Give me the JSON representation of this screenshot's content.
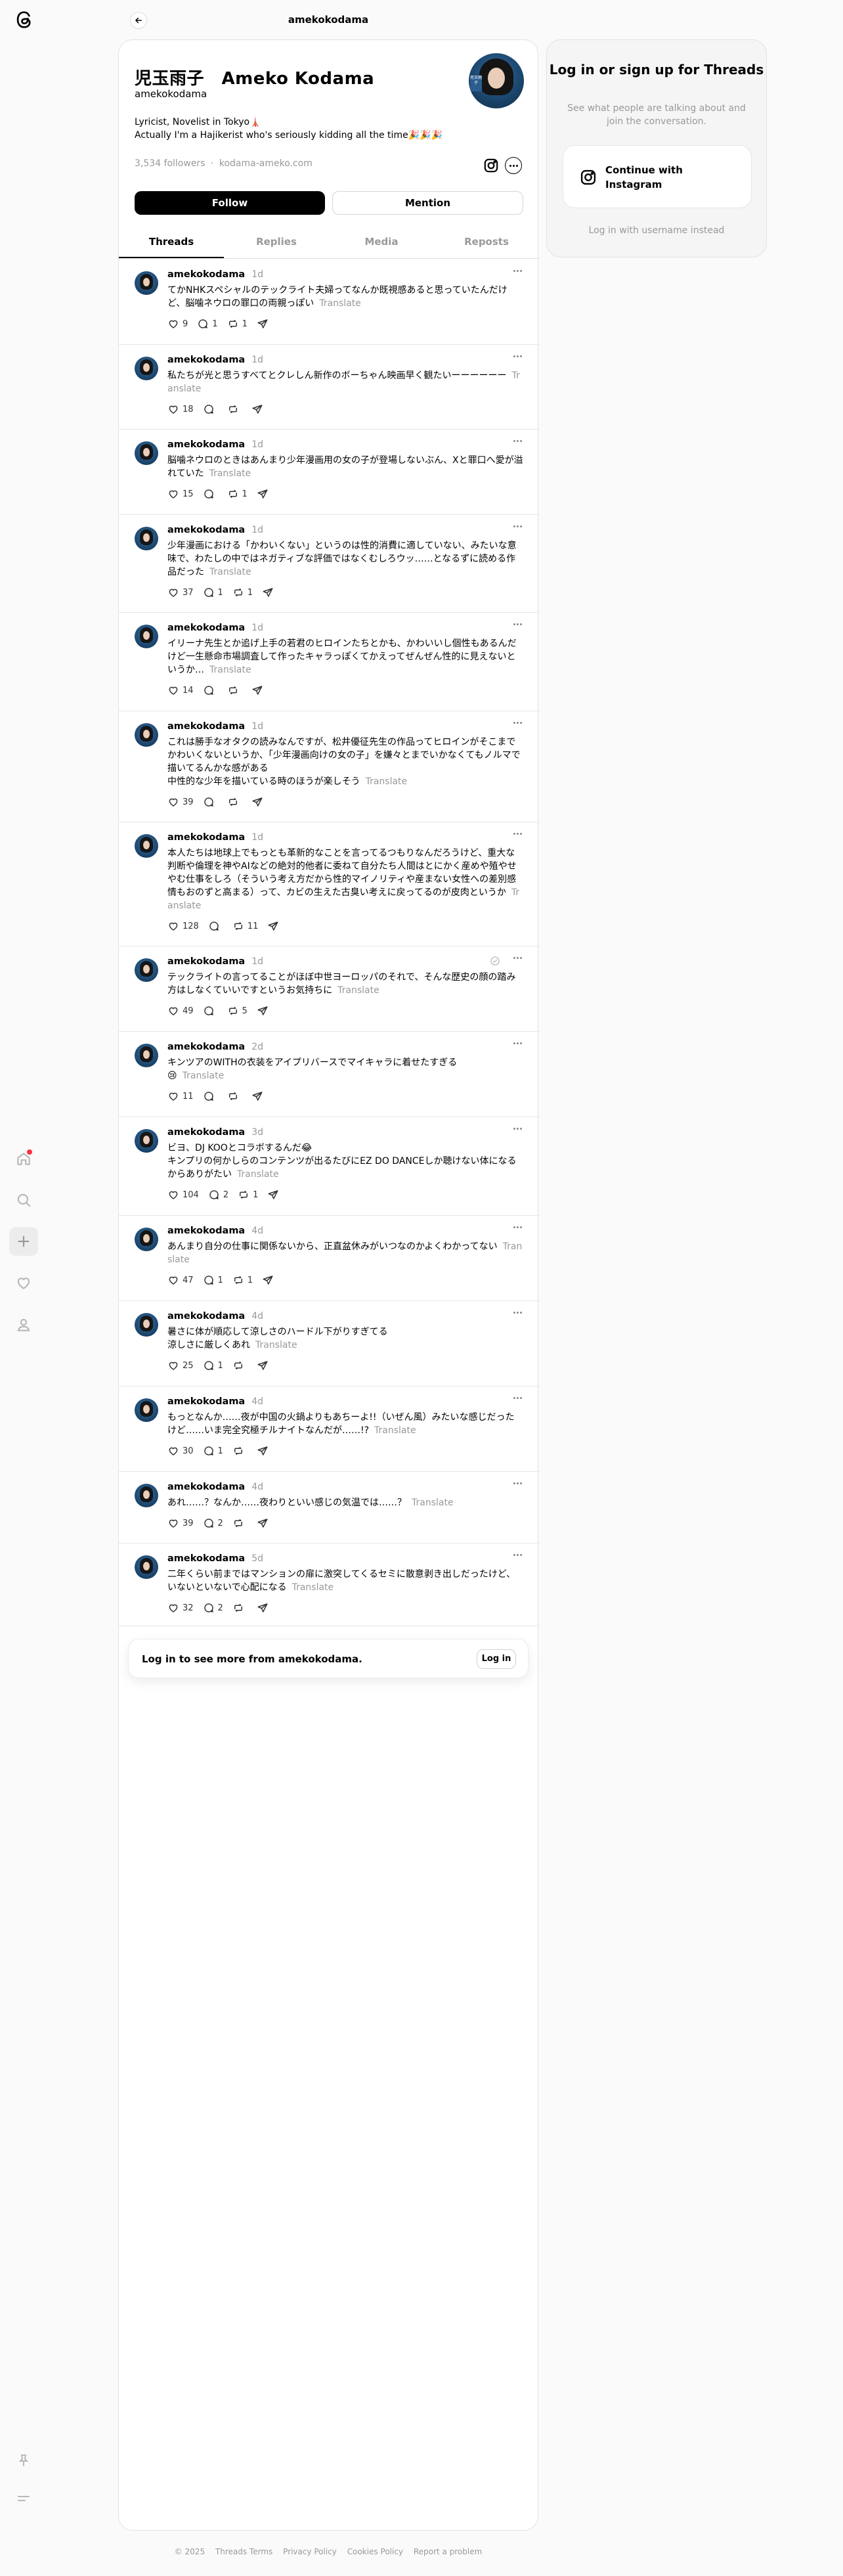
{
  "header": {
    "title": "amekokodama"
  },
  "profile": {
    "name": "児玉雨子　Ameko Kodama",
    "handle": "amekokodama",
    "avatar_stamp": "児玉雨子",
    "bio_line1": "Lyricist, Novelist in Tokyo🗼",
    "bio_line2": "Actually I'm a Hajikerist who's seriously kidding all the time🎉🎉🎉",
    "followers": "3,534 followers",
    "separator": "·",
    "link": "kodama-ameko.com",
    "follow_label": "Follow",
    "mention_label": "Mention"
  },
  "tabs": [
    "Threads",
    "Replies",
    "Media",
    "Reposts"
  ],
  "translate_label": "Translate",
  "posts": [
    {
      "user": "amekokodama",
      "time": "1d",
      "text": "てかNHKスペシャルのテックライト夫婦ってなんか既視感あると思っていたんだけど、脳噛ネウロの罪口の両親っぽい",
      "likes": "9",
      "replies": "1",
      "reposts": "1",
      "verified": false
    },
    {
      "user": "amekokodama",
      "time": "1d",
      "text": "私たちが光と思うすべてとクレしん新作のボーちゃん映画早く観たいーーーーーー",
      "likes": "18",
      "replies": "",
      "reposts": "",
      "verified": false
    },
    {
      "user": "amekokodama",
      "time": "1d",
      "text": "脳噛ネウロのときはあんまり少年漫画用の女の子が登場しないぶん、Xと罪口へ愛が溢れていた",
      "likes": "15",
      "replies": "",
      "reposts": "1",
      "verified": false
    },
    {
      "user": "amekokodama",
      "time": "1d",
      "text": "少年漫画における「かわいくない」というのは性的消費に適していない、みたいな意味で、わたしの中ではネガティブな評価ではなくむしろウッ……となるずに読める作品だった",
      "likes": "37",
      "replies": "1",
      "reposts": "1",
      "verified": false
    },
    {
      "user": "amekokodama",
      "time": "1d",
      "text": "イリーナ先生とか追げ上手の若君のヒロインたちとかも、かわいいし個性もあるんだけど一生懸命市場調査して作ったキャラっぽくてかえってぜんぜん性的に見えないというか…",
      "likes": "14",
      "replies": "",
      "reposts": "",
      "verified": false
    },
    {
      "user": "amekokodama",
      "time": "1d",
      "text": "これは勝手なオタクの読みなんですが、松井優征先生の作品ってヒロインがそこまでかわいくないというか、「少年漫画向けの女の子」を嫌々とまでいかなくてもノルマで描いてるんかな感がある\n中性的な少年を描いている時のほうが楽しそう",
      "likes": "39",
      "replies": "",
      "reposts": "",
      "verified": false
    },
    {
      "user": "amekokodama",
      "time": "1d",
      "text": "本人たちは地球上でもっとも革新的なことを言ってるつもりなんだろうけど、重大な判断や倫理を神やAIなどの絶対的他者に委ねて自分たち人間はとにかく産めや殖やせやむ仕事をしろ（そういう考え方だから性的マイノリティや産まない女性への差別感情もおのずと高まる）って、カビの生えた古臭い考えに戻ってるのが皮肉というか",
      "likes": "128",
      "replies": "",
      "reposts": "11",
      "verified": false
    },
    {
      "user": "amekokodama",
      "time": "1d",
      "text": "テックライトの言ってることがほぼ中世ヨーロッパのそれで、そんな歴史の顔の踏み方はしなくていいですというお気持ちに",
      "likes": "49",
      "replies": "",
      "reposts": "5",
      "verified": true
    },
    {
      "user": "amekokodama",
      "time": "2d",
      "text": "キンツアのWITHの衣装をアイプリバースでマイキャラに着せたすぎる\n😢",
      "likes": "11",
      "replies": "",
      "reposts": "",
      "verified": false
    },
    {
      "user": "amekokodama",
      "time": "3d",
      "text": "ビヨ、DJ KOOとコラボするんだ😂\nキンプリの何かしらのコンテンツが出るたびにEZ DO DANCEしか聴けない体になるからありがたい",
      "likes": "104",
      "replies": "2",
      "reposts": "1",
      "verified": false
    },
    {
      "user": "amekokodama",
      "time": "4d",
      "text": "あんまり自分の仕事に関係ないから、正直盆休みがいつなのかよくわかってない",
      "likes": "47",
      "replies": "1",
      "reposts": "1",
      "verified": false
    },
    {
      "user": "amekokodama",
      "time": "4d",
      "text": "暑さに体が順応して涼しさのハードル下がりすぎてる\n涼しさに厳しくあれ",
      "likes": "25",
      "replies": "1",
      "reposts": "",
      "verified": false
    },
    {
      "user": "amekokodama",
      "time": "4d",
      "text": "もっとなんか……夜が中国の火鍋よりもあちーよ!!（いぜん風）みたいな感じだったけど……いま完全究極チルナイトなんだが……!?",
      "likes": "30",
      "replies": "1",
      "reposts": "",
      "verified": false
    },
    {
      "user": "amekokodama",
      "time": "4d",
      "text": "あれ……？なんか……夜わりといい感じの気温では……？",
      "likes": "39",
      "replies": "2",
      "reposts": "",
      "verified": false
    },
    {
      "user": "amekokodama",
      "time": "5d",
      "text": "二年くらい前まではマンションの扉に激突してくるセミに散意剥き出しだったけど、いないといないで心配になる",
      "likes": "32",
      "replies": "2",
      "reposts": "",
      "verified": false
    }
  ],
  "login_prompt": {
    "text": "Log in to see more from amekokodama.",
    "button": "Log in"
  },
  "sidebar": {
    "heading": "Log in or sign up for Threads",
    "subtext": "See what people are talking about and join the conversation.",
    "instagram_label": "Continue with Instagram",
    "username_link": "Log in with username instead"
  },
  "footer": [
    "© 2025",
    "Threads Terms",
    "Privacy Policy",
    "Cookies Policy",
    "Report a problem"
  ],
  "colors": {
    "accent": "#000000",
    "muted": "#999999",
    "notification": "#ff3040"
  }
}
